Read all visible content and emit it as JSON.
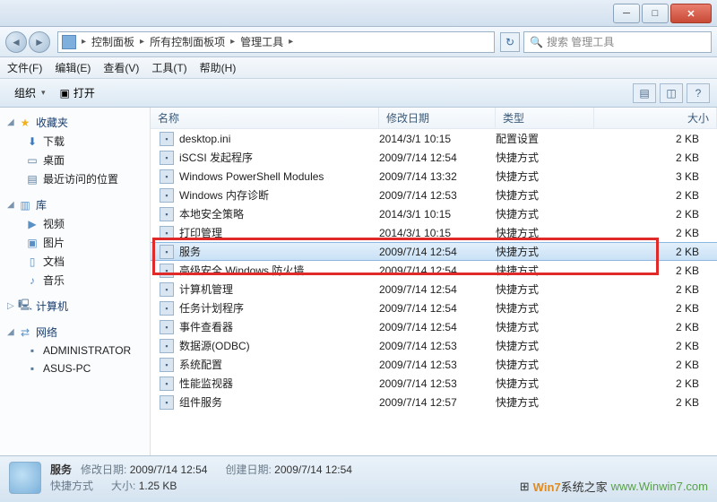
{
  "title_buttons": {
    "min": "─",
    "max": "□",
    "close": "✕"
  },
  "breadcrumb": {
    "root_icon": "▣",
    "seg1": "控制面板",
    "seg2": "所有控制面板项",
    "seg3": "管理工具",
    "chev": "▸",
    "refresh": "↻"
  },
  "search": {
    "placeholder": "搜索 管理工具",
    "icon": "🔍"
  },
  "menus": {
    "file": "文件(F)",
    "edit": "编辑(E)",
    "view": "查看(V)",
    "tools": "工具(T)",
    "help": "帮助(H)"
  },
  "toolbar": {
    "organize": "组织",
    "open": "打开",
    "drop": "▾",
    "view_icon": "▤",
    "pane_icon": "◫",
    "help_icon": "?"
  },
  "sidebar": {
    "favorites": {
      "label": "收藏夹",
      "items": [
        {
          "icon": "⬇",
          "label": "下载"
        },
        {
          "icon": "▭",
          "label": "桌面"
        },
        {
          "icon": "▤",
          "label": "最近访问的位置"
        }
      ]
    },
    "libraries": {
      "label": "库",
      "items": [
        {
          "icon": "▶",
          "label": "视频"
        },
        {
          "icon": "▣",
          "label": "图片"
        },
        {
          "icon": "▯",
          "label": "文档"
        },
        {
          "icon": "♪",
          "label": "音乐"
        }
      ]
    },
    "computer": {
      "label": "计算机"
    },
    "network": {
      "label": "网络",
      "items": [
        {
          "icon": "▪",
          "label": "ADMINISTRATOR"
        },
        {
          "icon": "▪",
          "label": "ASUS-PC"
        }
      ]
    }
  },
  "columns": {
    "name": "名称",
    "date": "修改日期",
    "type": "类型",
    "size": "大小"
  },
  "files": [
    {
      "name": "desktop.ini",
      "date": "2014/3/1 10:15",
      "type": "配置设置",
      "size": "2 KB"
    },
    {
      "name": "iSCSI 发起程序",
      "date": "2009/7/14 12:54",
      "type": "快捷方式",
      "size": "2 KB"
    },
    {
      "name": "Windows PowerShell Modules",
      "date": "2009/7/14 13:32",
      "type": "快捷方式",
      "size": "3 KB"
    },
    {
      "name": "Windows 内存诊断",
      "date": "2009/7/14 12:53",
      "type": "快捷方式",
      "size": "2 KB"
    },
    {
      "name": "本地安全策略",
      "date": "2014/3/1 10:15",
      "type": "快捷方式",
      "size": "2 KB"
    },
    {
      "name": "打印管理",
      "date": "2014/3/1 10:15",
      "type": "快捷方式",
      "size": "2 KB"
    },
    {
      "name": "服务",
      "date": "2009/7/14 12:54",
      "type": "快捷方式",
      "size": "2 KB",
      "selected": true
    },
    {
      "name": "高级安全 Windows 防火墙",
      "date": "2009/7/14 12:54",
      "type": "快捷方式",
      "size": "2 KB"
    },
    {
      "name": "计算机管理",
      "date": "2009/7/14 12:54",
      "type": "快捷方式",
      "size": "2 KB"
    },
    {
      "name": "任务计划程序",
      "date": "2009/7/14 12:54",
      "type": "快捷方式",
      "size": "2 KB"
    },
    {
      "name": "事件查看器",
      "date": "2009/7/14 12:54",
      "type": "快捷方式",
      "size": "2 KB"
    },
    {
      "name": "数据源(ODBC)",
      "date": "2009/7/14 12:53",
      "type": "快捷方式",
      "size": "2 KB"
    },
    {
      "name": "系统配置",
      "date": "2009/7/14 12:53",
      "type": "快捷方式",
      "size": "2 KB"
    },
    {
      "name": "性能监视器",
      "date": "2009/7/14 12:53",
      "type": "快捷方式",
      "size": "2 KB"
    },
    {
      "name": "组件服务",
      "date": "2009/7/14 12:57",
      "type": "快捷方式",
      "size": "2 KB"
    }
  ],
  "status": {
    "title": "服务",
    "mod_label": "修改日期:",
    "mod_value": "2009/7/14 12:54",
    "create_label": "创建日期:",
    "create_value": "2009/7/14 12:54",
    "type_label": "快捷方式",
    "size_label": "大小:",
    "size_value": "1.25 KB"
  },
  "watermark": {
    "brand": "Win7",
    "text": "系统之家",
    "domain": "www.Winwin7.com"
  },
  "icons": {
    "star": "★",
    "folder": "📁",
    "expand": "▷",
    "collapse": "◢"
  }
}
